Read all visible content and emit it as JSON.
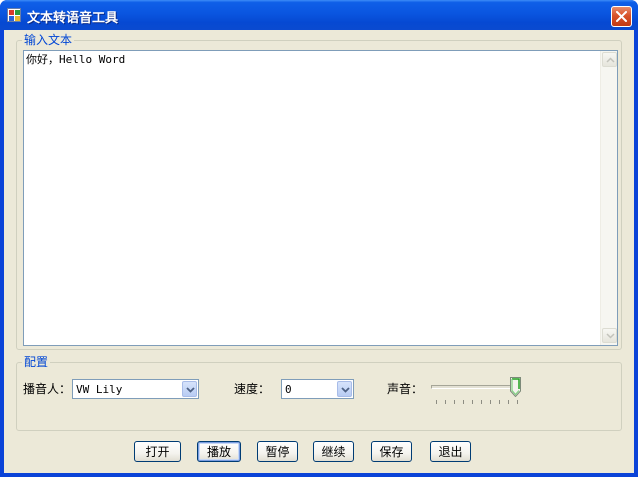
{
  "window": {
    "title": "文本转语音工具",
    "icon": "app-icon",
    "close_icon": "close-icon"
  },
  "input_group": {
    "label": "输入文本",
    "text": "你好，Hello Word"
  },
  "config_group": {
    "label": "配置",
    "speaker_label": "播音人：",
    "speaker_value": "VW Lily",
    "speed_label": "速度：",
    "speed_value": "0",
    "volume_label": "声音：",
    "volume_level": 1.0
  },
  "buttons": {
    "open": "打开",
    "play": "播放",
    "pause": "暂停",
    "resume": "继续",
    "save": "保存",
    "exit": "退出"
  },
  "colors": {
    "titlebar": "#0a55e0",
    "group_label": "#0046d5",
    "client_bg": "#ece9d8"
  }
}
